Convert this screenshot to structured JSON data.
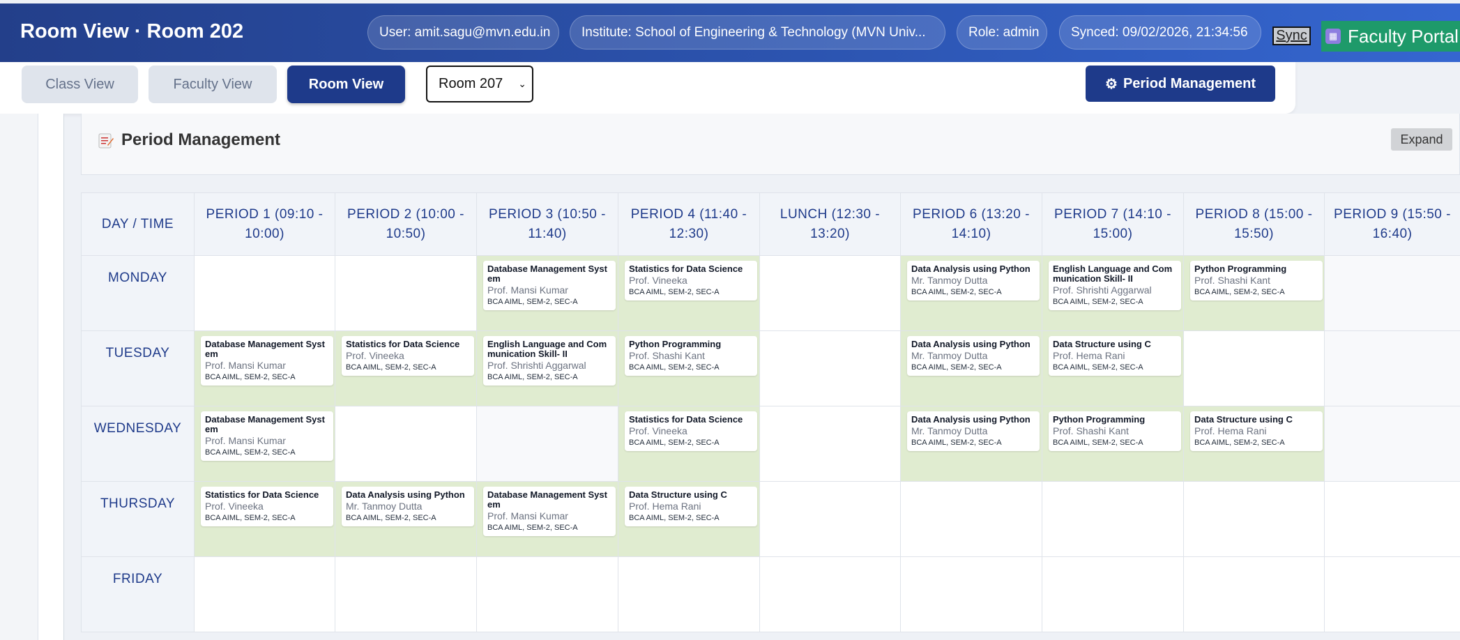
{
  "header": {
    "title": "Room View · Room 202",
    "user": "User: amit.sagu@mvn.edu.in",
    "institute": "Institute: School of Engineering & Technology (MVN Univ...",
    "role": "Role: admin",
    "synced": "Synced: 09/02/2026, 21:34:56",
    "sync_label": "Sync",
    "portal_label": "Faculty Portal"
  },
  "toolbar": {
    "tabs": [
      "Class View",
      "Faculty View",
      "Room View"
    ],
    "active_tab": "Room View",
    "room_select_value": "Room 207",
    "period_management_label": "Period Management"
  },
  "panel": {
    "title": "Period Management",
    "expand_label": "Expand"
  },
  "timetable": {
    "headers": [
      "DAY / TIME",
      "PERIOD 1 (09:10 - 10:00)",
      "PERIOD 2 (10:00 - 10:50)",
      "PERIOD 3 (10:50 - 11:40)",
      "PERIOD 4 (11:40 - 12:30)",
      "LUNCH (12:30 - 13:20)",
      "PERIOD 6 (13:20 - 14:10)",
      "PERIOD 7 (14:10 - 15:00)",
      "PERIOD 8 (15:00 - 15:50)",
      "PERIOD 9 (15:50 - 16:40)"
    ],
    "rows": [
      {
        "day": "MONDAY",
        "cells": [
          {
            "state": "empty"
          },
          {
            "state": "empty"
          },
          {
            "state": "filled",
            "subject": "Database Management System",
            "faculty": "Prof. Mansi Kumar",
            "group": "BCA AIML, SEM-2, SEC-A"
          },
          {
            "state": "filled",
            "subject": "Statistics for Data Science",
            "faculty": "Prof. Vineeka",
            "group": "BCA AIML, SEM-2, SEC-A"
          },
          {
            "state": "lunch"
          },
          {
            "state": "filled",
            "subject": "Data Analysis using Python",
            "faculty": "Mr. Tanmoy Dutta",
            "group": "BCA AIML, SEM-2, SEC-A"
          },
          {
            "state": "filled",
            "subject": "English Language and Communication Skill- II",
            "faculty": "Prof. Shrishti Aggarwal",
            "group": "BCA AIML, SEM-2, SEC-A"
          },
          {
            "state": "filled",
            "subject": "Python Programming",
            "faculty": "Prof. Shashi Kant",
            "group": "BCA AIML, SEM-2, SEC-A"
          },
          {
            "state": "gray"
          }
        ]
      },
      {
        "day": "TUESDAY",
        "cells": [
          {
            "state": "filled",
            "subject": "Database Management System",
            "faculty": "Prof. Mansi Kumar",
            "group": "BCA AIML, SEM-2, SEC-A"
          },
          {
            "state": "filled",
            "subject": "Statistics for Data Science",
            "faculty": "Prof. Vineeka",
            "group": "BCA AIML, SEM-2, SEC-A"
          },
          {
            "state": "filled",
            "subject": "English Language and Communication Skill- II",
            "faculty": "Prof. Shrishti Aggarwal",
            "group": "BCA AIML, SEM-2, SEC-A"
          },
          {
            "state": "filled",
            "subject": "Python Programming",
            "faculty": "Prof. Shashi Kant",
            "group": "BCA AIML, SEM-2, SEC-A"
          },
          {
            "state": "lunch"
          },
          {
            "state": "filled",
            "subject": "Data Analysis using Python",
            "faculty": "Mr. Tanmoy Dutta",
            "group": "BCA AIML, SEM-2, SEC-A"
          },
          {
            "state": "filled",
            "subject": "Data Structure using C",
            "faculty": "Prof. Hema Rani",
            "group": "BCA AIML, SEM-2, SEC-A"
          },
          {
            "state": "empty"
          },
          {
            "state": "gray"
          }
        ]
      },
      {
        "day": "WEDNESDAY",
        "cells": [
          {
            "state": "filled",
            "subject": "Database Management System",
            "faculty": "Prof. Mansi Kumar",
            "group": "BCA AIML, SEM-2, SEC-A"
          },
          {
            "state": "empty"
          },
          {
            "state": "gray"
          },
          {
            "state": "filled",
            "subject": "Statistics for Data Science",
            "faculty": "Prof. Vineeka",
            "group": "BCA AIML, SEM-2, SEC-A"
          },
          {
            "state": "lunch"
          },
          {
            "state": "filled",
            "subject": "Data Analysis using Python",
            "faculty": "Mr. Tanmoy Dutta",
            "group": "BCA AIML, SEM-2, SEC-A"
          },
          {
            "state": "filled",
            "subject": "Python Programming",
            "faculty": "Prof. Shashi Kant",
            "group": "BCA AIML, SEM-2, SEC-A"
          },
          {
            "state": "filled",
            "subject": "Data Structure using C",
            "faculty": "Prof. Hema Rani",
            "group": "BCA AIML, SEM-2, SEC-A"
          },
          {
            "state": "gray"
          }
        ]
      },
      {
        "day": "THURSDAY",
        "cells": [
          {
            "state": "filled",
            "subject": "Statistics for Data Science",
            "faculty": "Prof. Vineeka",
            "group": "BCA AIML, SEM-2, SEC-A"
          },
          {
            "state": "filled",
            "subject": "Data Analysis using Python",
            "faculty": "Mr. Tanmoy Dutta",
            "group": "BCA AIML, SEM-2, SEC-A"
          },
          {
            "state": "filled",
            "subject": "Database Management System",
            "faculty": "Prof. Mansi Kumar",
            "group": "BCA AIML, SEM-2, SEC-A"
          },
          {
            "state": "filled",
            "subject": "Data Structure using C",
            "faculty": "Prof. Hema Rani",
            "group": "BCA AIML, SEM-2, SEC-A"
          },
          {
            "state": "lunch"
          },
          {
            "state": "empty"
          },
          {
            "state": "empty"
          },
          {
            "state": "empty"
          },
          {
            "state": "empty"
          }
        ]
      },
      {
        "day": "FRIDAY",
        "cells": [
          {
            "state": "empty"
          },
          {
            "state": "empty"
          },
          {
            "state": "empty"
          },
          {
            "state": "empty"
          },
          {
            "state": "lunch"
          },
          {
            "state": "empty"
          },
          {
            "state": "empty"
          },
          {
            "state": "empty"
          },
          {
            "state": "empty"
          }
        ]
      }
    ]
  },
  "colors": {
    "header_start": "#233f8a",
    "header_end": "#3566d0",
    "accent": "#1e3a8a",
    "filled_cell": "#e0ecd0",
    "portal_button": "#1e9a6a"
  }
}
